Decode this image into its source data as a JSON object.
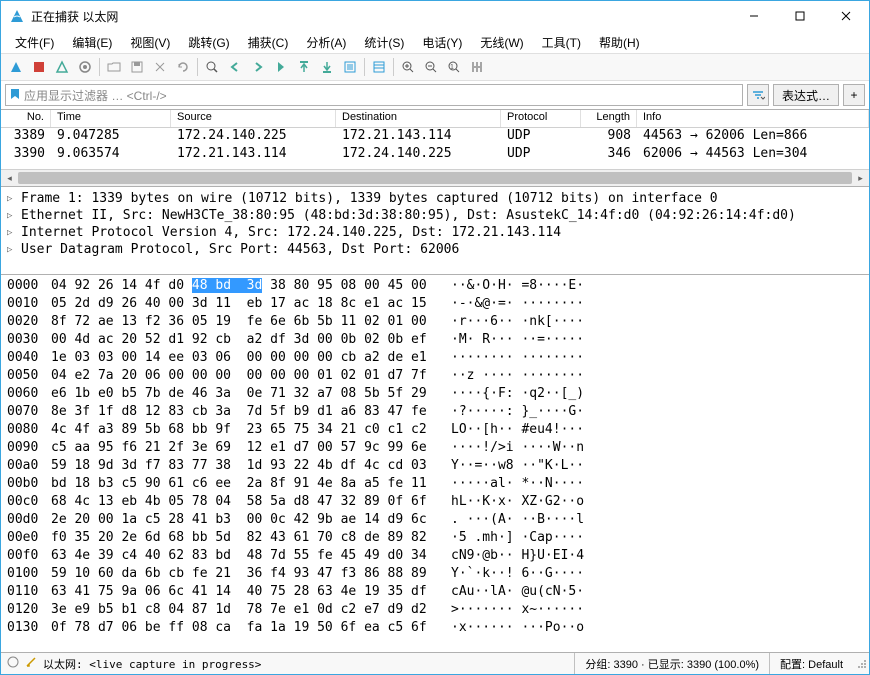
{
  "window": {
    "title": "正在捕获 以太网"
  },
  "menu": {
    "file": "文件(F)",
    "edit": "编辑(E)",
    "view": "视图(V)",
    "go": "跳转(G)",
    "capture": "捕获(C)",
    "analyze": "分析(A)",
    "statistics": "统计(S)",
    "telephony": "电话(Y)",
    "wireless": "无线(W)",
    "tools": "工具(T)",
    "help": "帮助(H)"
  },
  "filter": {
    "placeholder": "应用显示过滤器 … <Ctrl-/>",
    "expr_button": "表达式…"
  },
  "packet_list": {
    "headers": {
      "no": "No.",
      "time": "Time",
      "source": "Source",
      "destination": "Destination",
      "protocol": "Protocol",
      "length": "Length",
      "info": "Info"
    },
    "rows": [
      {
        "no": "3389",
        "time": "9.047285",
        "src": "172.24.140.225",
        "dst": "172.21.143.114",
        "proto": "UDP",
        "len": "908",
        "info": "44563 → 62006 Len=866"
      },
      {
        "no": "3390",
        "time": "9.063574",
        "src": "172.21.143.114",
        "dst": "172.24.140.225",
        "proto": "UDP",
        "len": "346",
        "info": "62006 → 44563 Len=304"
      }
    ]
  },
  "details": [
    "Frame 1: 1339 bytes on wire (10712 bits), 1339 bytes captured (10712 bits) on interface 0",
    "Ethernet II, Src: NewH3CTe_38:80:95 (48:bd:3d:38:80:95), Dst: AsustekC_14:4f:d0 (04:92:26:14:4f:d0)",
    "Internet Protocol Version 4, Src: 172.24.140.225, Dst: 172.21.143.114",
    "User Datagram Protocol, Src Port: 44563, Dst Port: 62006"
  ],
  "hex": [
    {
      "off": "0000",
      "b": "04 92 26 14 4f d0 48 bd  3d 38 80 95 08 00 45 00",
      "a": "··&·O·H· =8····E·",
      "sel_start": 18,
      "sel_end": 27
    },
    {
      "off": "0010",
      "b": "05 2d d9 26 40 00 3d 11  eb 17 ac 18 8c e1 ac 15",
      "a": "·-·&@·=· ········"
    },
    {
      "off": "0020",
      "b": "8f 72 ae 13 f2 36 05 19  fe 6e 6b 5b 11 02 01 00",
      "a": "·r···6·· ·nk[····"
    },
    {
      "off": "0030",
      "b": "00 4d ac 20 52 d1 92 cb  a2 df 3d 00 0b 02 0b ef",
      "a": "·M· R··· ··=·····"
    },
    {
      "off": "0040",
      "b": "1e 03 03 00 14 ee 03 06  00 00 00 00 cb a2 de e1",
      "a": "········ ········"
    },
    {
      "off": "0050",
      "b": "04 e2 7a 20 06 00 00 00  00 00 00 01 02 01 d7 7f",
      "a": "··z ···· ········"
    },
    {
      "off": "0060",
      "b": "e6 1b e0 b5 7b de 46 3a  0e 71 32 a7 08 5b 5f 29",
      "a": "····{·F: ·q2··[_)"
    },
    {
      "off": "0070",
      "b": "8e 3f 1f d8 12 83 cb 3a  7d 5f b9 d1 a6 83 47 fe",
      "a": "·?·····: }_····G·"
    },
    {
      "off": "0080",
      "b": "4c 4f a3 89 5b 68 bb 9f  23 65 75 34 21 c0 c1 c2",
      "a": "LO··[h·· #eu4!···"
    },
    {
      "off": "0090",
      "b": "c5 aa 95 f6 21 2f 3e 69  12 e1 d7 00 57 9c 99 6e",
      "a": "····!/>i ····W··n"
    },
    {
      "off": "00a0",
      "b": "59 18 9d 3d f7 83 77 38  1d 93 22 4b df 4c cd 03",
      "a": "Y··=··w8 ··\"K·L··"
    },
    {
      "off": "00b0",
      "b": "bd 18 b3 c5 90 61 c6 ee  2a 8f 91 4e 8a a5 fe 11",
      "a": "·····al· *··N····"
    },
    {
      "off": "00c0",
      "b": "68 4c 13 eb 4b 05 78 04  58 5a d8 47 32 89 0f 6f",
      "a": "hL··K·x· XZ·G2··o"
    },
    {
      "off": "00d0",
      "b": "2e 20 00 1a c5 28 41 b3  00 0c 42 9b ae 14 d9 6c",
      "a": ". ···(A· ··B····l"
    },
    {
      "off": "00e0",
      "b": "f0 35 20 2e 6d 68 bb 5d  82 43 61 70 c8 de 89 82",
      "a": "·5 .mh·] ·Cap····"
    },
    {
      "off": "00f0",
      "b": "63 4e 39 c4 40 62 83 bd  48 7d 55 fe 45 49 d0 34",
      "a": "cN9·@b·· H}U·EI·4"
    },
    {
      "off": "0100",
      "b": "59 10 60 da 6b cb fe 21  36 f4 93 47 f3 86 88 89",
      "a": "Y·`·k··! 6··G····"
    },
    {
      "off": "0110",
      "b": "63 41 75 9a 06 6c 41 14  40 75 28 63 4e 19 35 df",
      "a": "cAu··lA· @u(cN·5·"
    },
    {
      "off": "0120",
      "b": "3e e9 b5 b1 c8 04 87 1d  78 7e e1 0d c2 e7 d9 d2",
      "a": ">······· x~······"
    },
    {
      "off": "0130",
      "b": "0f 78 d7 06 be ff 08 ca  fa 1a 19 50 6f ea c5 6f",
      "a": "·x······ ···Po··o"
    }
  ],
  "statusbar": {
    "iface": "以太网: <live capture in progress>",
    "packets": "分组: 3390 · 已显示: 3390 (100.0%)",
    "profile": "配置: Default"
  },
  "chart_data": null
}
